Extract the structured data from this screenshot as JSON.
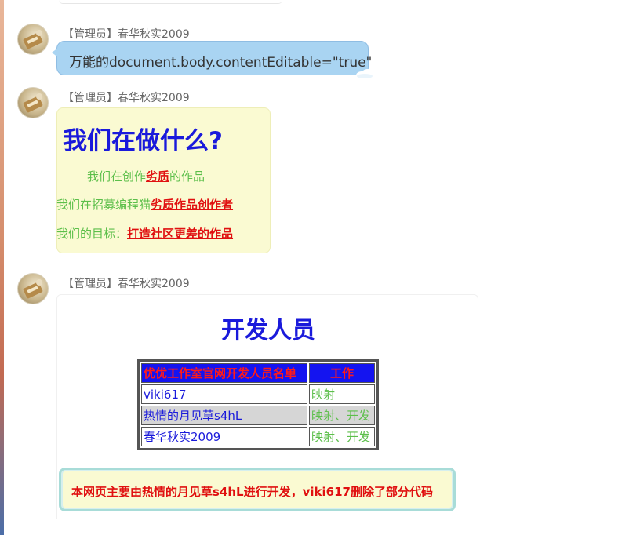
{
  "messages": [
    {
      "sender": "【管理员】春华秋实2009",
      "text": "万能的document.body.contentEditable=\"true\""
    },
    {
      "sender": "【管理员】春华秋实2009",
      "title": "我们在做什么?",
      "lines": [
        {
          "prefix": "我们在创作",
          "link": "劣质",
          "suffix": "的作品"
        },
        {
          "prefix": "我们在招募编程猫",
          "link": "劣质作品创作者",
          "suffix": ""
        },
        {
          "prefix": "我们的目标：",
          "link": "打造社区更差的作品",
          "suffix": ""
        }
      ]
    },
    {
      "sender": "【管理员】春华秋实2009",
      "title": "开发人员",
      "table": {
        "headers": [
          "优优工作室官网开发人员名单",
          "工作"
        ],
        "rows": [
          [
            "viki617",
            "映射"
          ],
          [
            "热情的月见草s4hL",
            "映射、开发"
          ],
          [
            "春华秋实2009",
            "映射、开发"
          ]
        ]
      },
      "notice": "本网页主要由热情的月见草s4hL进行开发，viki617删除了部分代码"
    }
  ],
  "colors": {
    "blue_bubble": "#a9d4f2",
    "yellow_bubble": "#fafad2",
    "title_blue": "#1a1adb",
    "link_red": "#e01010",
    "text_green": "#5cbf4a"
  }
}
